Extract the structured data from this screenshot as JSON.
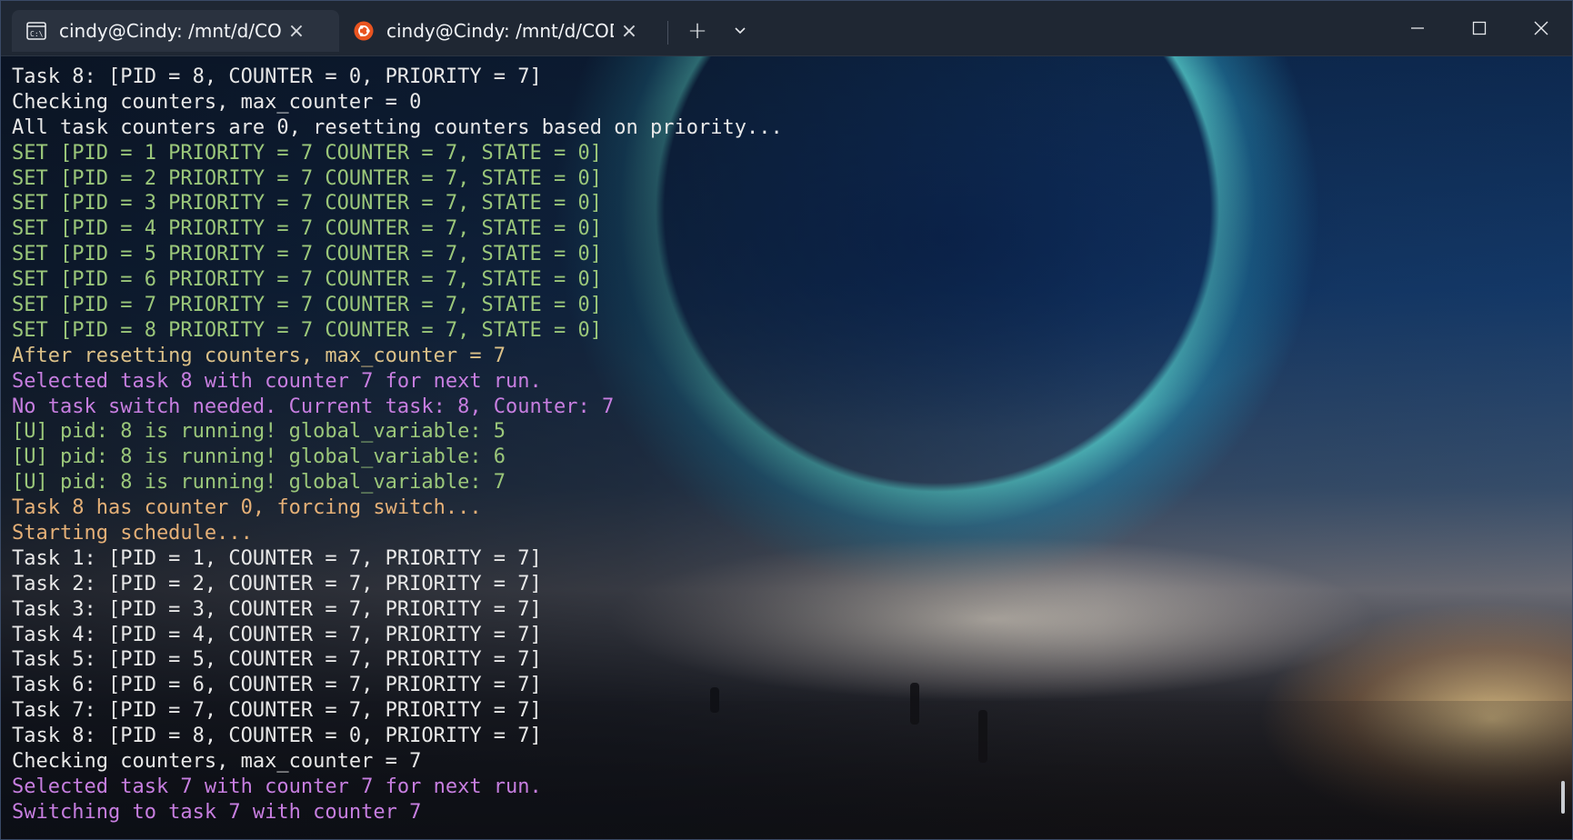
{
  "window": {
    "tabs": [
      {
        "title": "cindy@Cindy: /mnt/d/COD",
        "icon": "terminal-cmd-icon",
        "active": true
      },
      {
        "title": "cindy@Cindy: /mnt/d/COD",
        "icon": "ubuntu-logo-icon",
        "active": false
      }
    ],
    "toolbar": {
      "new_tab_label": "+",
      "dropdown_label": "⌄"
    },
    "controls": {
      "minimize_label": "—",
      "maximize_label": "☐",
      "close_label": "✕"
    }
  },
  "terminal": {
    "colors": {
      "white": "#e8e8e8",
      "green": "#9bc77a",
      "purple": "#c77ee0",
      "yellow": "#dcc188",
      "orange": "#e5b077"
    },
    "lines": [
      {
        "text": "Task 8: [PID = 8, COUNTER = 0, PRIORITY = 7]",
        "color": "white"
      },
      {
        "text": "Checking counters, max_counter = 0",
        "color": "white"
      },
      {
        "text": "All task counters are 0, resetting counters based on priority...",
        "color": "white"
      },
      {
        "text": "SET [PID = 1 PRIORITY = 7 COUNTER = 7, STATE = 0]",
        "color": "green"
      },
      {
        "text": "SET [PID = 2 PRIORITY = 7 COUNTER = 7, STATE = 0]",
        "color": "green"
      },
      {
        "text": "SET [PID = 3 PRIORITY = 7 COUNTER = 7, STATE = 0]",
        "color": "green"
      },
      {
        "text": "SET [PID = 4 PRIORITY = 7 COUNTER = 7, STATE = 0]",
        "color": "green"
      },
      {
        "text": "SET [PID = 5 PRIORITY = 7 COUNTER = 7, STATE = 0]",
        "color": "green"
      },
      {
        "text": "SET [PID = 6 PRIORITY = 7 COUNTER = 7, STATE = 0]",
        "color": "green"
      },
      {
        "text": "SET [PID = 7 PRIORITY = 7 COUNTER = 7, STATE = 0]",
        "color": "green"
      },
      {
        "text": "SET [PID = 8 PRIORITY = 7 COUNTER = 7, STATE = 0]",
        "color": "green"
      },
      {
        "text": "After resetting counters, max_counter = 7",
        "color": "yellow"
      },
      {
        "text": "Selected task 8 with counter 7 for next run.",
        "color": "purple"
      },
      {
        "text": "No task switch needed. Current task: 8, Counter: 7",
        "color": "purple"
      },
      {
        "text": "[U] pid: 8 is running! global_variable: 5",
        "color": "green"
      },
      {
        "text": "[U] pid: 8 is running! global_variable: 6",
        "color": "green"
      },
      {
        "text": "[U] pid: 8 is running! global_variable: 7",
        "color": "green"
      },
      {
        "text": "Task 8 has counter 0, forcing switch...",
        "color": "orange"
      },
      {
        "text": "Starting schedule...",
        "color": "orange"
      },
      {
        "text": "Task 1: [PID = 1, COUNTER = 7, PRIORITY = 7]",
        "color": "white"
      },
      {
        "text": "Task 2: [PID = 2, COUNTER = 7, PRIORITY = 7]",
        "color": "white"
      },
      {
        "text": "Task 3: [PID = 3, COUNTER = 7, PRIORITY = 7]",
        "color": "white"
      },
      {
        "text": "Task 4: [PID = 4, COUNTER = 7, PRIORITY = 7]",
        "color": "white"
      },
      {
        "text": "Task 5: [PID = 5, COUNTER = 7, PRIORITY = 7]",
        "color": "white"
      },
      {
        "text": "Task 6: [PID = 6, COUNTER = 7, PRIORITY = 7]",
        "color": "white"
      },
      {
        "text": "Task 7: [PID = 7, COUNTER = 7, PRIORITY = 7]",
        "color": "white"
      },
      {
        "text": "Task 8: [PID = 8, COUNTER = 0, PRIORITY = 7]",
        "color": "white"
      },
      {
        "text": "Checking counters, max_counter = 7",
        "color": "white"
      },
      {
        "text": "Selected task 7 with counter 7 for next run.",
        "color": "purple"
      },
      {
        "text": "Switching to task 7 with counter 7",
        "color": "purple"
      }
    ]
  }
}
